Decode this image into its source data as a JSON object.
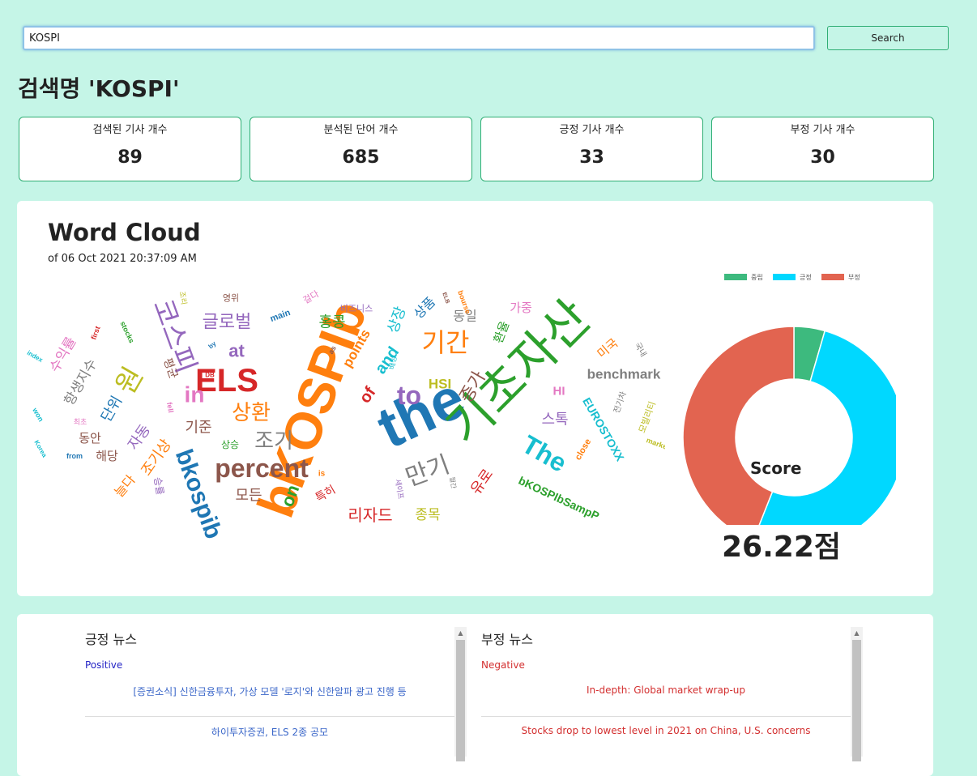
{
  "search": {
    "value": "KOSPI",
    "button_label": "Search"
  },
  "page_title": "검색명 'KOSPI'",
  "stats": [
    {
      "label": "검색된 기사 개수",
      "value": "89"
    },
    {
      "label": "분석된 단어 개수",
      "value": "685"
    },
    {
      "label": "긍정 기사 개수",
      "value": "33"
    },
    {
      "label": "부정 기사 개수",
      "value": "30"
    }
  ],
  "word_cloud": {
    "title": "Word Cloud",
    "subtitle": "of 06 Oct 2021 20:37:09 AM",
    "words": [
      {
        "text": "bKOSPIb",
        "color": "#ff7f0e"
      },
      {
        "text": "the",
        "color": "#1f77b4"
      },
      {
        "text": "기초자산",
        "color": "#2ca02c"
      },
      {
        "text": "ELS",
        "color": "#d62728"
      },
      {
        "text": "percent",
        "color": "#8c564b"
      },
      {
        "text": "bkospib",
        "color": "#1f77b4"
      },
      {
        "text": "코스피",
        "color": "#9467bd"
      },
      {
        "text": "원",
        "color": "#bcbd22"
      },
      {
        "text": "in",
        "color": "#e377c2"
      },
      {
        "text": "to",
        "color": "#9467bd"
      },
      {
        "text": "The",
        "color": "#17becf"
      },
      {
        "text": "기간",
        "color": "#ff7f0e"
      },
      {
        "text": "상환",
        "color": "#ff7f0e"
      },
      {
        "text": "조기",
        "color": "#7f7f7f"
      },
      {
        "text": "만기",
        "color": "#7f7f7f"
      },
      {
        "text": "글로벌",
        "color": "#9467bd"
      },
      {
        "text": "benchmark",
        "color": "#7f7f7f"
      },
      {
        "text": "홍콩",
        "color": "#2ca02c"
      },
      {
        "text": "at",
        "color": "#9467bd"
      },
      {
        "text": "points",
        "color": "#ff7f0e"
      },
      {
        "text": "and",
        "color": "#17becf"
      },
      {
        "text": "of",
        "color": "#d62728"
      },
      {
        "text": "on",
        "color": "#2ca02c"
      },
      {
        "text": "HSI",
        "color": "#bcbd22"
      },
      {
        "text": "HI",
        "color": "#e377c2"
      },
      {
        "text": "EUROSTOXX",
        "color": "#17becf"
      },
      {
        "text": "bKOSPIbSampP",
        "color": "#2ca02c"
      },
      {
        "text": "리자드",
        "color": "#d62728"
      },
      {
        "text": "종목",
        "color": "#bcbd22"
      },
      {
        "text": "모든",
        "color": "#8c564b"
      },
      {
        "text": "기준",
        "color": "#8c564b"
      },
      {
        "text": "자동",
        "color": "#9467bd"
      },
      {
        "text": "조기상",
        "color": "#ff7f0e"
      },
      {
        "text": "단위",
        "color": "#1f77b4"
      },
      {
        "text": "항생지수",
        "color": "#7f7f7f"
      },
      {
        "text": "수익률",
        "color": "#e377c2"
      },
      {
        "text": "해당",
        "color": "#8c564b"
      },
      {
        "text": "동안",
        "color": "#8c564b"
      },
      {
        "text": "스톡",
        "color": "#9467bd"
      },
      {
        "text": "유로",
        "color": "#d62728"
      },
      {
        "text": "증가",
        "color": "#8c564b"
      },
      {
        "text": "상장",
        "color": "#17becf"
      },
      {
        "text": "상품",
        "color": "#1f77b4"
      },
      {
        "text": "동일",
        "color": "#7f7f7f"
      },
      {
        "text": "가중",
        "color": "#e377c2"
      },
      {
        "text": "환율",
        "color": "#2ca02c"
      },
      {
        "text": "미국",
        "color": "#ff7f0e"
      },
      {
        "text": "close",
        "color": "#ff7f0e"
      },
      {
        "text": "market",
        "color": "#bcbd22"
      },
      {
        "text": "main",
        "color": "#1f77b4"
      },
      {
        "text": "stocks",
        "color": "#2ca02c"
      },
      {
        "text": "index",
        "color": "#17becf"
      },
      {
        "text": "first",
        "color": "#d62728"
      },
      {
        "text": "won",
        "color": "#17becf"
      },
      {
        "text": "Korea",
        "color": "#17becf"
      },
      {
        "text": "from",
        "color": "#1f77b4"
      },
      {
        "text": "is",
        "color": "#ff7f0e"
      },
      {
        "text": "as",
        "color": "#8c564b"
      },
      {
        "text": "fell",
        "color": "#e377c2"
      },
      {
        "text": "by",
        "color": "#1f77b4"
      },
      {
        "text": "DB",
        "color": "#d62728"
      },
      {
        "text": "ELB",
        "color": "#8c564b"
      },
      {
        "text": "bourse",
        "color": "#ff7f0e"
      },
      {
        "text": "비즈니스",
        "color": "#9467bd"
      },
      {
        "text": "걸다",
        "color": "#e377c2"
      },
      {
        "text": "영위",
        "color": "#8c564b"
      },
      {
        "text": "조리",
        "color": "#bcbd22"
      },
      {
        "text": "평균",
        "color": "#8c564b"
      },
      {
        "text": "상승",
        "color": "#2ca02c"
      },
      {
        "text": "특히",
        "color": "#d62728"
      },
      {
        "text": "최초",
        "color": "#e377c2"
      },
      {
        "text": "늘다",
        "color": "#ff7f0e"
      },
      {
        "text": "승률",
        "color": "#9467bd"
      },
      {
        "text": "국내",
        "color": "#7f7f7f"
      },
      {
        "text": "전기차",
        "color": "#7f7f7f"
      },
      {
        "text": "모빌리티",
        "color": "#bcbd22"
      },
      {
        "text": "세이프",
        "color": "#9467bd"
      },
      {
        "text": "월간",
        "color": "#7f7f7f"
      },
      {
        "text": "배정",
        "color": "#17becf"
      }
    ]
  },
  "chart_data": {
    "type": "pie",
    "donut": true,
    "categories": [
      "중립",
      "긍정",
      "부정"
    ],
    "values": [
      4.5,
      51.5,
      44.0
    ],
    "colors": [
      "#3dba7e",
      "#00d8ff",
      "#e26450"
    ],
    "legend": "top",
    "center_label": "Score"
  },
  "score_text": "26.22점",
  "news": {
    "positive": {
      "heading": "긍정 뉴스",
      "sub": "Positive",
      "sub_color": "#2525c6",
      "items": [
        "[증권소식] 신한금융투자, 가상 모델 '로지'와 신한알파 광고 진행 등",
        "하이투자증권, ELS 2종 공모"
      ]
    },
    "negative": {
      "heading": "부정 뉴스",
      "sub": "Negative",
      "sub_color": "#d32f2f",
      "items": [
        "In-depth: Global market wrap-up",
        "Stocks drop to lowest level in 2021 on China, U.S. concerns"
      ]
    }
  }
}
